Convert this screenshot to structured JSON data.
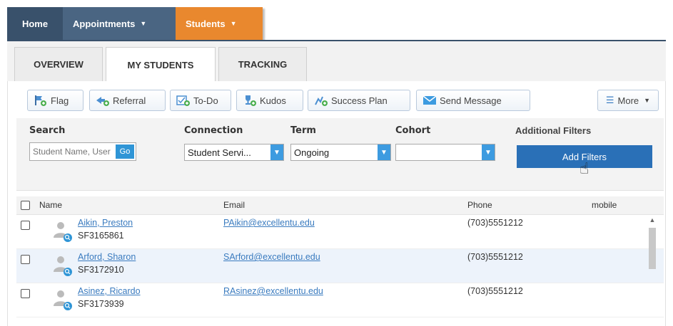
{
  "nav": {
    "home": "Home",
    "appointments": "Appointments",
    "students": "Students"
  },
  "tabs": [
    "OVERVIEW",
    "MY STUDENTS",
    "TRACKING"
  ],
  "actions": {
    "flag": "Flag",
    "referral": "Referral",
    "todo": "To-Do",
    "kudos": "Kudos",
    "success_plan": "Success Plan",
    "send_message": "Send Message",
    "more": "More"
  },
  "filters": {
    "search_label": "Search",
    "search_placeholder": "Student Name, User",
    "go": "Go",
    "connection_label": "Connection",
    "connection_value": "Student Servi...",
    "term_label": "Term",
    "term_value": "Ongoing",
    "cohort_label": "Cohort",
    "cohort_value": "",
    "additional_label": "Additional Filters",
    "add_filters_button": "Add Filters"
  },
  "table": {
    "columns": [
      "Name",
      "Email",
      "Phone",
      "mobile"
    ],
    "rows": [
      {
        "name": "Aikin, Preston",
        "id": "SF3165861",
        "email": "PAikin@excellentu.edu",
        "phone": "(703)5551212",
        "mobile": ""
      },
      {
        "name": "Arford, Sharon",
        "id": "SF3172910",
        "email": "SArford@excellentu.edu",
        "phone": "(703)5551212",
        "mobile": ""
      },
      {
        "name": "Asinez, Ricardo",
        "id": "SF3173939",
        "email": "RAsinez@excellentu.edu",
        "phone": "(703)5551212",
        "mobile": ""
      }
    ]
  },
  "colors": {
    "nav_dark": "#39516b",
    "nav_mid": "#4a6582",
    "nav_active": "#e9882e",
    "primary_button": "#2a70b7",
    "link": "#3a7bbf"
  }
}
